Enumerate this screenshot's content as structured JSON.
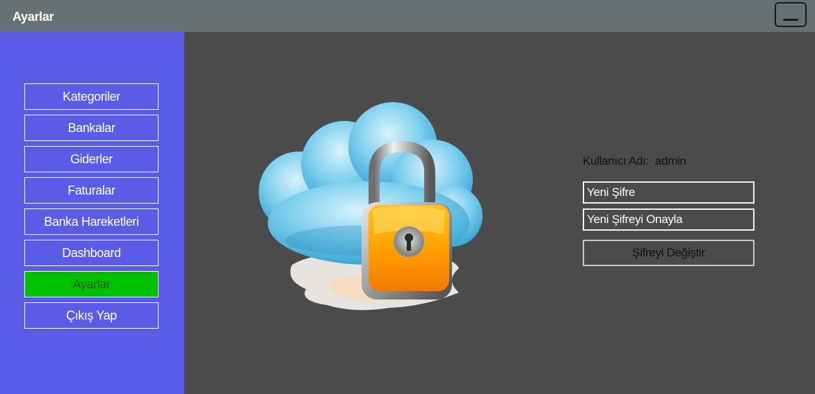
{
  "window": {
    "title": "Ayarlar",
    "minimize_icon": "minimize-icon"
  },
  "sidebar": {
    "background": "#5a5ce8",
    "items": [
      {
        "label": "Kategoriler"
      },
      {
        "label": "Bankalar"
      },
      {
        "label": "Giderler"
      },
      {
        "label": "Faturalar"
      },
      {
        "label": "Banka Hareketleri"
      },
      {
        "label": "Dashboard"
      },
      {
        "label": "Ayarlar",
        "active": true,
        "active_color": "#00c000"
      },
      {
        "label": "Çıkış Yap"
      }
    ]
  },
  "main": {
    "illustration_icon": "cloud-lock-icon",
    "user": {
      "label": "Kullanıcı Adı:",
      "value": "admin"
    },
    "form": {
      "new_password_placeholder": "Yeni Şifre",
      "confirm_password_placeholder": "Yeni Şifreyi Onayla",
      "submit_label": "Şifreyi Değiştir"
    }
  },
  "colors": {
    "titlebar": "#667173",
    "content_bg": "#4b4b4b",
    "active_item": "#00c000"
  }
}
